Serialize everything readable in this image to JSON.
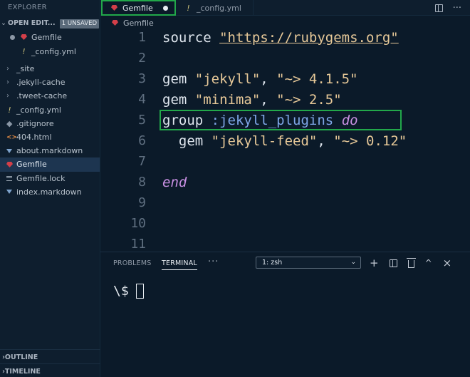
{
  "sidebar": {
    "title": "EXPLORER",
    "open_editors": {
      "label": "OPEN EDIT...",
      "badge": "1 UNSAVED",
      "items": [
        {
          "name": "Gemfile",
          "icon": "ruby-icon",
          "modified": true
        },
        {
          "name": "_config.yml",
          "icon": "yml-icon",
          "modified": false
        }
      ]
    },
    "tree": [
      {
        "name": "_site",
        "icon": "chevron-right-icon"
      },
      {
        "name": ".jekyll-cache",
        "icon": "chevron-right-icon"
      },
      {
        "name": ".tweet-cache",
        "icon": "chevron-right-icon"
      },
      {
        "name": "_config.yml",
        "icon": "yml-icon"
      },
      {
        "name": ".gitignore",
        "icon": "git-icon"
      },
      {
        "name": "404.html",
        "icon": "html-icon"
      },
      {
        "name": "about.markdown",
        "icon": "markdown-icon"
      },
      {
        "name": "Gemfile",
        "icon": "ruby-icon",
        "active": true
      },
      {
        "name": "Gemfile.lock",
        "icon": "lines-icon"
      },
      {
        "name": "index.markdown",
        "icon": "markdown-icon"
      }
    ],
    "outline_label": "OUTLINE",
    "timeline_label": "TIMELINE"
  },
  "tabs": [
    {
      "label": "Gemfile",
      "icon": "ruby-icon",
      "active": true,
      "modified": true
    },
    {
      "label": "_config.yml",
      "icon": "yml-icon",
      "yml_glyph": "!",
      "active": false
    }
  ],
  "breadcrumb": {
    "file": "Gemfile"
  },
  "editor": {
    "line_numbers": [
      "1",
      "2",
      "3",
      "4",
      "5",
      "6",
      "7",
      "8",
      "9",
      "10",
      "11"
    ],
    "lines": {
      "l1": {
        "kw": "source ",
        "str": "\"https://rubygems.org\""
      },
      "l3": {
        "kw": "gem ",
        "a": "\"jekyll\"",
        "sep": ", ",
        "b": "\"~> 4.1.5\""
      },
      "l4": {
        "kw": "gem ",
        "a": "\"minima\"",
        "sep": ", ",
        "b": "\"~> 2.5\""
      },
      "l5": {
        "kw": "group ",
        "sym": ":jekyll_plugins",
        "sp": " ",
        "do": "do"
      },
      "l6": {
        "kw": "  gem ",
        "a": "\"jekyll-feed\"",
        "sep": ", ",
        "b": "\"~> 0.12\""
      },
      "l8": {
        "end": "end"
      }
    }
  },
  "panel": {
    "tabs": {
      "problems": "PROBLEMS",
      "terminal": "TERMINAL",
      "more": "···"
    },
    "terminal_select": "1: zsh",
    "actions": {
      "add": "+",
      "split": "split-icon",
      "trash": "trash-icon",
      "max": "^",
      "close": "×"
    },
    "prompt": "\\$"
  },
  "colors": {
    "highlight_border": "#22a84a",
    "ruby": "#d33f49",
    "string": "#e6c898",
    "symbol": "#7fa7e8",
    "keyword_italic": "#c990e3"
  }
}
